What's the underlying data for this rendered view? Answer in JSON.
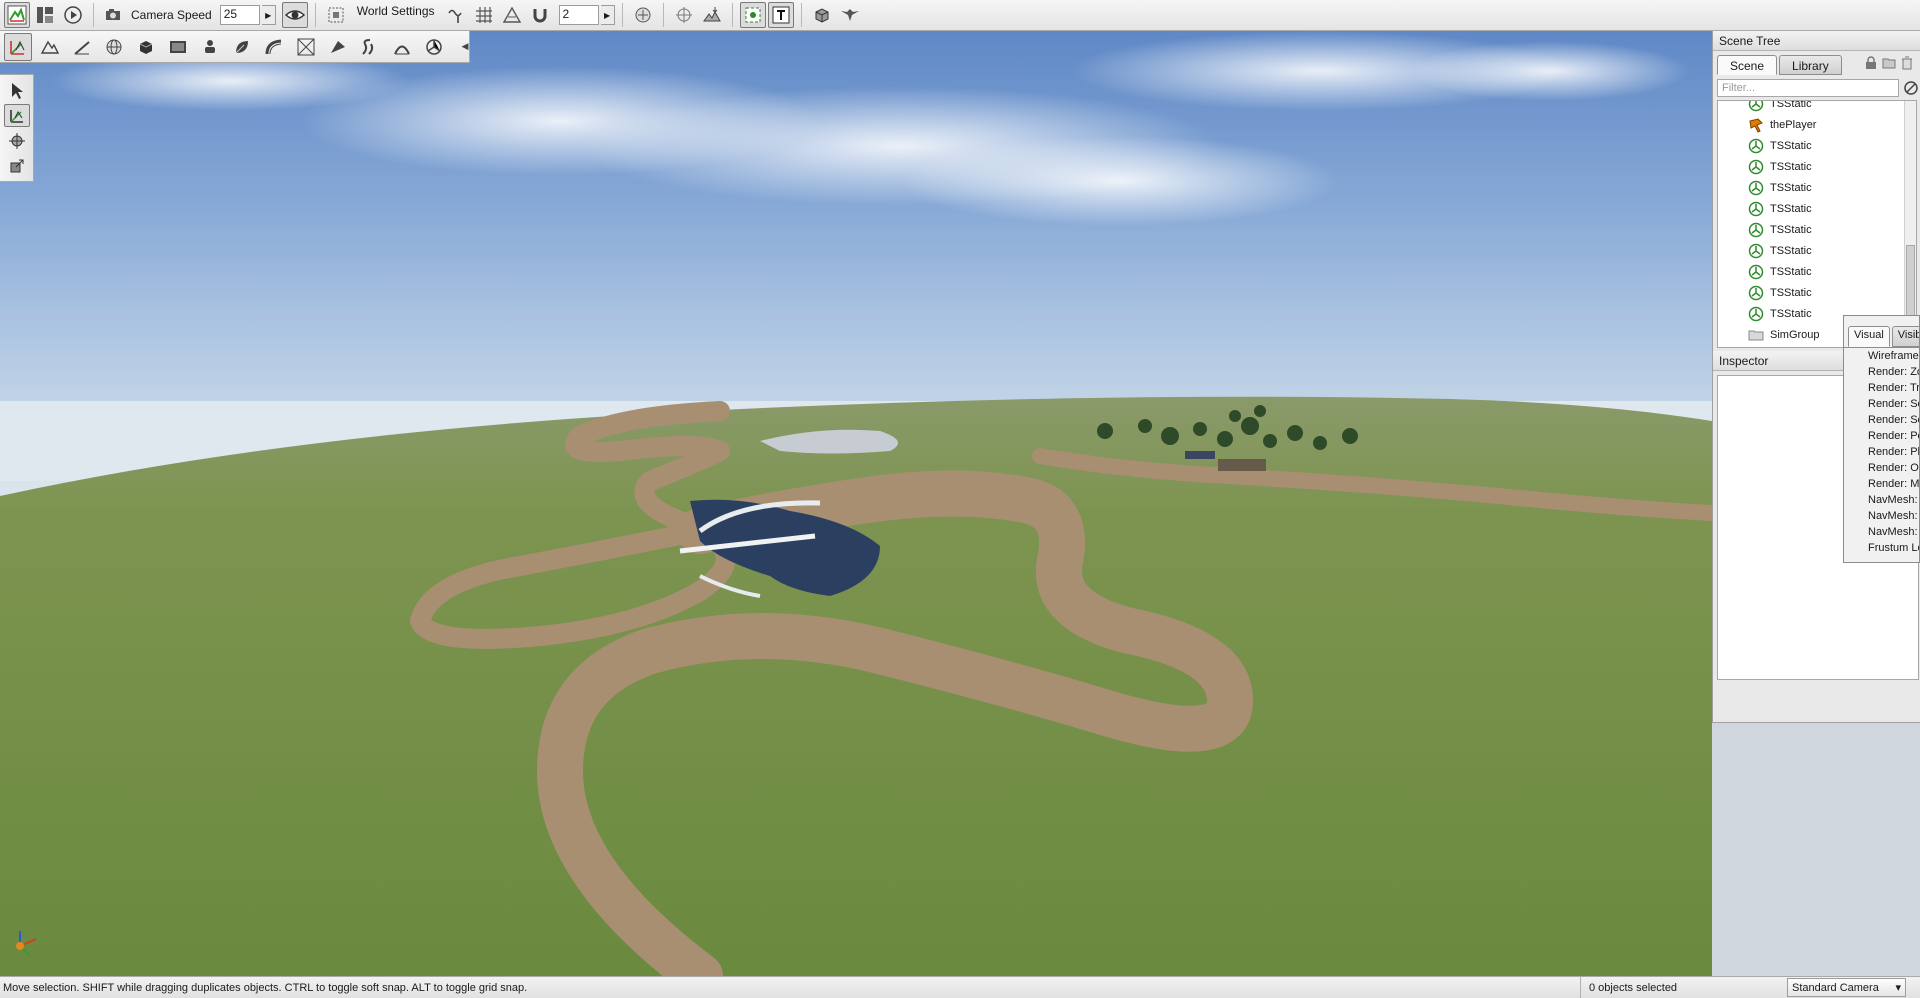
{
  "top_toolbar": {
    "camera_speed_label": "Camera Speed",
    "camera_speed_value": "25",
    "world_settings_label": "World Settings",
    "grid_value": "2"
  },
  "scene_tree": {
    "title": "Scene Tree",
    "tabs": [
      "Scene",
      "Library"
    ],
    "selected_tab": "Scene",
    "filter_placeholder": "Filter...",
    "items": [
      {
        "label": "TSStatic",
        "icon": "tsstatic-icon"
      },
      {
        "label": "thePlayer",
        "icon": "player-icon"
      },
      {
        "label": "TSStatic",
        "icon": "tsstatic-icon"
      },
      {
        "label": "TSStatic",
        "icon": "tsstatic-icon"
      },
      {
        "label": "TSStatic",
        "icon": "tsstatic-icon"
      },
      {
        "label": "TSStatic",
        "icon": "tsstatic-icon"
      },
      {
        "label": "TSStatic",
        "icon": "tsstatic-icon"
      },
      {
        "label": "TSStatic",
        "icon": "tsstatic-icon"
      },
      {
        "label": "TSStatic",
        "icon": "tsstatic-icon"
      },
      {
        "label": "TSStatic",
        "icon": "tsstatic-icon"
      },
      {
        "label": "TSStatic",
        "icon": "tsstatic-icon"
      },
      {
        "label": "SimGroup",
        "icon": "folder-icon"
      }
    ]
  },
  "inspector": {
    "title": "Inspector"
  },
  "visual_popup": {
    "tabs": [
      "Visual",
      "Visib"
    ],
    "selected_tab": "Visual",
    "items": [
      "Wireframe",
      "Render: Zo",
      "Render: Tr",
      "Render: So",
      "Render: So",
      "Render: Po",
      "Render: Ph",
      "Render: Oc",
      "Render: Mi",
      "NavMesh:",
      "NavMesh:",
      "NavMesh:",
      "Frustum Lo"
    ]
  },
  "status_bar": {
    "message": "Move selection.  SHIFT while dragging duplicates objects.  CTRL to toggle soft snap.  ALT to toggle grid snap.",
    "selection_count": "0 objects selected",
    "camera_mode": "Standard Camera"
  },
  "colors": {
    "tsstatic_icon": "#2e8b2e",
    "player_icon": "#e07b00",
    "grass": "#6f8a45",
    "dirt_path": "#a98f72",
    "water": "#2b4060",
    "sky_top": "#5f88c6"
  }
}
